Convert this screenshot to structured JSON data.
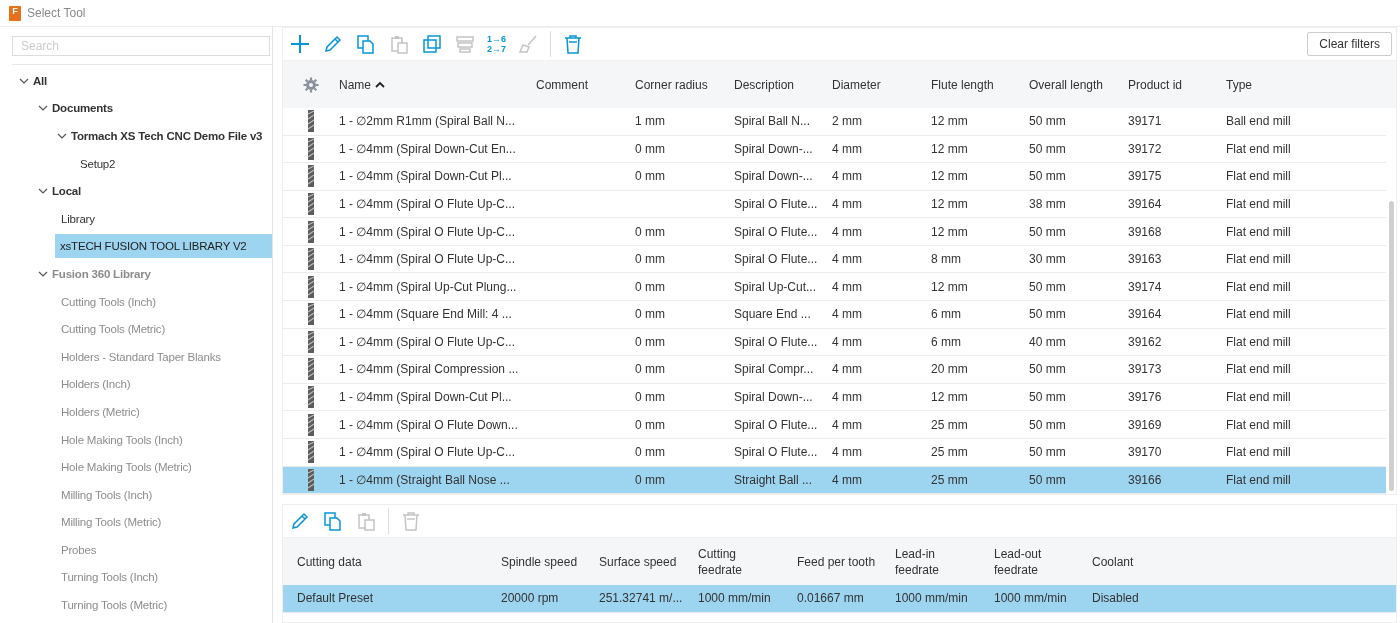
{
  "window": {
    "title": "Select Tool",
    "icon_text": "F"
  },
  "search": {
    "placeholder": "Search"
  },
  "tree": [
    {
      "label": "All",
      "expanded": true,
      "selected": false,
      "disabled": false,
      "children": [
        {
          "label": "Documents",
          "expanded": true,
          "selected": false,
          "disabled": false,
          "children": [
            {
              "label": "Tormach XS Tech CNC Demo File v3",
              "expanded": true,
              "selected": false,
              "disabled": false,
              "children": [
                {
                  "label": "Setup2",
                  "selected": false,
                  "disabled": false
                }
              ]
            }
          ]
        },
        {
          "label": "Local",
          "expanded": true,
          "selected": false,
          "disabled": false,
          "children": [
            {
              "label": "Library",
              "selected": false,
              "disabled": false
            },
            {
              "label": "xsTECH FUSION TOOL LIBRARY V2",
              "selected": true,
              "disabled": false
            }
          ]
        },
        {
          "label": "Fusion 360 Library",
          "expanded": true,
          "selected": false,
          "disabled": true,
          "children": [
            {
              "label": "Cutting Tools (Inch)",
              "selected": false,
              "disabled": true
            },
            {
              "label": "Cutting Tools (Metric)",
              "selected": false,
              "disabled": true
            },
            {
              "label": "Holders - Standard Taper Blanks",
              "selected": false,
              "disabled": true
            },
            {
              "label": "Holders (Inch)",
              "selected": false,
              "disabled": true
            },
            {
              "label": "Holders (Metric)",
              "selected": false,
              "disabled": true
            },
            {
              "label": "Hole Making Tools (Inch)",
              "selected": false,
              "disabled": true
            },
            {
              "label": "Hole Making Tools (Metric)",
              "selected": false,
              "disabled": true
            },
            {
              "label": "Milling Tools (Inch)",
              "selected": false,
              "disabled": true
            },
            {
              "label": "Milling Tools (Metric)",
              "selected": false,
              "disabled": true
            },
            {
              "label": "Probes",
              "selected": false,
              "disabled": true
            },
            {
              "label": "Turning Tools (Inch)",
              "selected": false,
              "disabled": true
            },
            {
              "label": "Turning Tools (Metric)",
              "selected": false,
              "disabled": true
            }
          ]
        }
      ]
    }
  ],
  "toolbar": [
    {
      "kind": "add",
      "disabled": false
    },
    {
      "kind": "edit",
      "disabled": false
    },
    {
      "kind": "copy",
      "disabled": false
    },
    {
      "kind": "paste",
      "disabled": true
    },
    {
      "kind": "duplicate",
      "disabled": false
    },
    {
      "kind": "stack",
      "disabled": true
    },
    {
      "kind": "renumber",
      "disabled": false,
      "lines": [
        "1→6",
        "2→7"
      ]
    },
    {
      "kind": "brush",
      "disabled": true
    },
    {
      "kind": "separator"
    },
    {
      "kind": "delete",
      "disabled": false
    }
  ],
  "clear_filters_button": "Clear filters",
  "tools_table": {
    "sort_ascending": true,
    "columns": [
      "Name",
      "Comment",
      "Corner radius",
      "Description",
      "Diameter",
      "Flute length",
      "Overall length",
      "Product id",
      "Type"
    ],
    "rows": [
      {
        "name": "1 - ∅2mm R1mm (Spiral Ball N...",
        "corner_radius": "1 mm",
        "description": "Spiral Ball N...",
        "diameter": "2 mm",
        "flute_length": "12 mm",
        "overall_length": "50 mm",
        "product_id": "39171",
        "type": "Ball end mill",
        "selected": false
      },
      {
        "name": "1 - ∅4mm (Spiral Down-Cut En...",
        "corner_radius": "0 mm",
        "description": "Spiral Down-...",
        "diameter": "4 mm",
        "flute_length": "12 mm",
        "overall_length": "50 mm",
        "product_id": "39172",
        "type": "Flat end mill",
        "selected": false
      },
      {
        "name": "1 - ∅4mm (Spiral Down-Cut Pl...",
        "corner_radius": "0 mm",
        "description": "Spiral Down-...",
        "diameter": "4 mm",
        "flute_length": "12 mm",
        "overall_length": "50 mm",
        "product_id": "39175",
        "type": "Flat end mill",
        "selected": false
      },
      {
        "name": "1 - ∅4mm (Spiral O Flute Up-C...",
        "description": "Spiral O Flute...",
        "diameter": "4 mm",
        "flute_length": "12 mm",
        "overall_length": "38 mm",
        "product_id": "39164",
        "type": "Flat end mill",
        "selected": false
      },
      {
        "name": "1 - ∅4mm (Spiral O Flute Up-C...",
        "corner_radius": "0 mm",
        "description": "Spiral O Flute...",
        "diameter": "4 mm",
        "flute_length": "12 mm",
        "overall_length": "50 mm",
        "product_id": "39168",
        "type": "Flat end mill",
        "selected": false
      },
      {
        "name": "1 - ∅4mm (Spiral O Flute Up-C...",
        "corner_radius": "0 mm",
        "description": "Spiral O Flute...",
        "diameter": "4 mm",
        "flute_length": "8 mm",
        "overall_length": "30 mm",
        "product_id": "39163",
        "type": "Flat end mill",
        "selected": false
      },
      {
        "name": "1 - ∅4mm (Spiral Up-Cut Plung...",
        "corner_radius": "0 mm",
        "description": "Spiral Up-Cut...",
        "diameter": "4 mm",
        "flute_length": "12 mm",
        "overall_length": "50 mm",
        "product_id": "39174",
        "type": "Flat end mill",
        "selected": false
      },
      {
        "name": "1 - ∅4mm (Square End Mill: 4 ...",
        "corner_radius": "0 mm",
        "description": "Square End ...",
        "diameter": "4 mm",
        "flute_length": "6 mm",
        "overall_length": "50 mm",
        "product_id": "39164",
        "type": "Flat end mill",
        "selected": false
      },
      {
        "name": "1 - ∅4mm (Spiral O Flute Up-C...",
        "corner_radius": "0 mm",
        "description": "Spiral O Flute...",
        "diameter": "4 mm",
        "flute_length": "6 mm",
        "overall_length": "40 mm",
        "product_id": "39162",
        "type": "Flat end mill",
        "selected": false
      },
      {
        "name": "1 - ∅4mm (Spiral Compression ...",
        "corner_radius": "0 mm",
        "description": "Spiral Compr...",
        "diameter": "4 mm",
        "flute_length": "20 mm",
        "overall_length": "50 mm",
        "product_id": "39173",
        "type": "Flat end mill",
        "selected": false
      },
      {
        "name": "1 - ∅4mm (Spiral Down-Cut Pl...",
        "corner_radius": "0 mm",
        "description": "Spiral Down-...",
        "diameter": "4 mm",
        "flute_length": "12 mm",
        "overall_length": "50 mm",
        "product_id": "39176",
        "type": "Flat end mill",
        "selected": false
      },
      {
        "name": "1 - ∅4mm (Spiral O Flute Down...",
        "corner_radius": "0 mm",
        "description": "Spiral O Flute...",
        "diameter": "4 mm",
        "flute_length": "25 mm",
        "overall_length": "50 mm",
        "product_id": "39169",
        "type": "Flat end mill",
        "selected": false
      },
      {
        "name": "1 - ∅4mm (Spiral O Flute Up-C...",
        "corner_radius": "0 mm",
        "description": "Spiral O Flute...",
        "diameter": "4 mm",
        "flute_length": "25 mm",
        "overall_length": "50 mm",
        "product_id": "39170",
        "type": "Flat end mill",
        "selected": false
      },
      {
        "name": "1 - ∅4mm (Straight Ball Nose ...",
        "corner_radius": "0 mm",
        "description": "Straight Ball ...",
        "diameter": "4 mm",
        "flute_length": "25 mm",
        "overall_length": "50 mm",
        "product_id": "39166",
        "type": "Flat end mill",
        "selected": true
      }
    ]
  },
  "preset_toolbar": [
    {
      "kind": "edit",
      "disabled": false
    },
    {
      "kind": "copy",
      "disabled": false
    },
    {
      "kind": "paste",
      "disabled": true
    },
    {
      "kind": "separator"
    },
    {
      "kind": "delete",
      "disabled": true
    }
  ],
  "presets_table": {
    "columns": [
      "Cutting data",
      "Spindle speed",
      "Surface speed",
      "Cutting feedrate",
      "Feed per tooth",
      "Lead-in feedrate",
      "Lead-out feedrate",
      "Coolant"
    ],
    "rows": [
      {
        "cells": [
          "Default Preset",
          "20000 rpm",
          "251.32741 m/...",
          "1000 mm/min",
          "0.01667 mm",
          "1000 mm/min",
          "1000 mm/min",
          "Disabled"
        ],
        "selected": true
      }
    ]
  }
}
